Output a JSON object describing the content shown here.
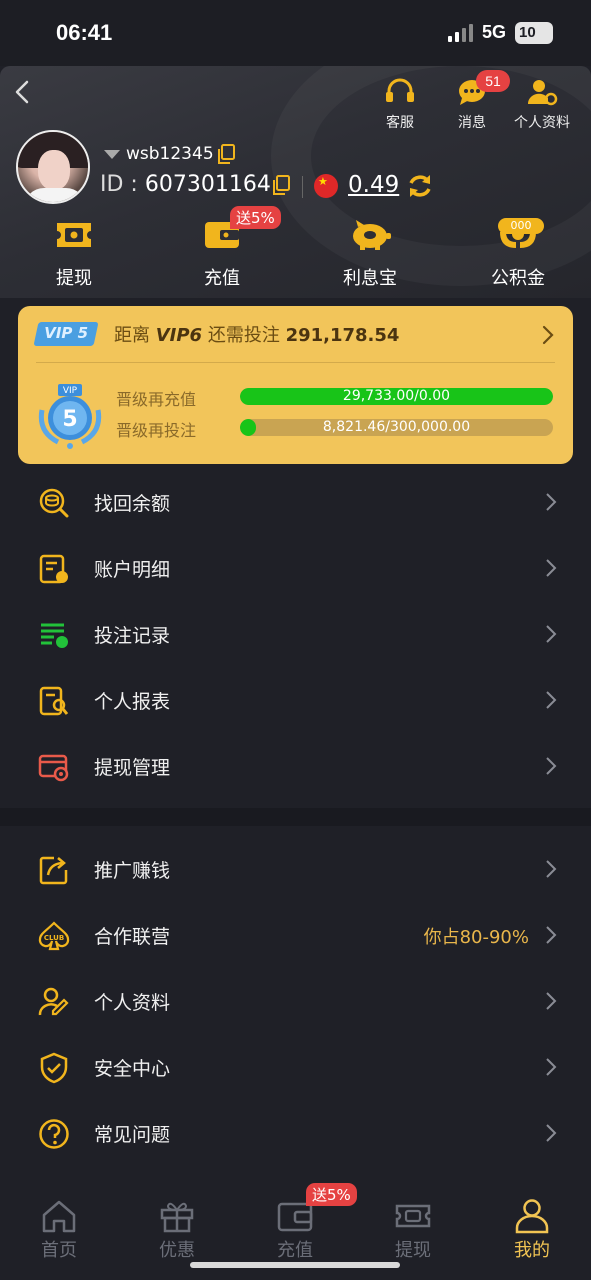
{
  "status_bar": {
    "time": "06:41",
    "network": "5G",
    "battery": "10"
  },
  "header": {
    "top_actions": [
      {
        "label": "客服",
        "icon": "headset-icon"
      },
      {
        "label": "消息",
        "icon": "chat-bubble-icon",
        "badge": "51"
      },
      {
        "label": "个人资料",
        "icon": "user-gear-icon"
      }
    ],
    "username": "wsb12345",
    "id_label": "ID",
    "id_value": "607301164",
    "balance": "0.49",
    "quick_actions": [
      {
        "label": "提现",
        "icon": "withdraw-ticket-icon"
      },
      {
        "label": "充值",
        "icon": "wallet-icon",
        "badge": "送5%"
      },
      {
        "label": "利息宝",
        "icon": "piggy-bank-icon"
      },
      {
        "label": "公积金",
        "icon": "fund-hands-icon",
        "badge": "000"
      }
    ]
  },
  "vip": {
    "current": "VIP 5",
    "medal_level": "5",
    "medal_tag": "VIP",
    "next_prefix": "距离",
    "next_level": "VIP6",
    "need_prefix": "还需投注",
    "need_amount": "291,178.54",
    "progress": [
      {
        "label": "晋级再充值",
        "text": "29,733.00/0.00",
        "fraction": 1.0
      },
      {
        "label": "晋级再投注",
        "text": "8,821.46/300,000.00",
        "fraction": 0.0294
      }
    ]
  },
  "menu_primary": [
    {
      "label": "找回余额",
      "icon": "coin-search-icon"
    },
    {
      "label": "账户明细",
      "icon": "account-detail-icon"
    },
    {
      "label": "投注记录",
      "icon": "bet-record-icon"
    },
    {
      "label": "个人报表",
      "icon": "report-search-icon"
    },
    {
      "label": "提现管理",
      "icon": "withdraw-card-icon"
    }
  ],
  "menu_secondary": [
    {
      "label": "推广赚钱",
      "icon": "share-icon"
    },
    {
      "label": "合作联营",
      "icon": "club-spade-icon",
      "extra": "你占80-90%"
    },
    {
      "label": "个人资料",
      "icon": "user-edit-icon"
    },
    {
      "label": "安全中心",
      "icon": "shield-check-icon"
    },
    {
      "label": "常见问题",
      "icon": "question-circle-icon"
    }
  ],
  "tabbar": {
    "tabs": [
      {
        "label": "首页",
        "icon": "home-icon"
      },
      {
        "label": "优惠",
        "icon": "gift-icon"
      },
      {
        "label": "充值",
        "icon": "wallet-icon",
        "badge": "送5%"
      },
      {
        "label": "提现",
        "icon": "withdraw-ticket-icon"
      },
      {
        "label": "我的",
        "icon": "user-icon",
        "active": true
      }
    ]
  },
  "colors": {
    "accent": "#f1c453",
    "badge": "#e54242",
    "progress_fill": "#18c418",
    "vip_card": "#f2c55a"
  }
}
